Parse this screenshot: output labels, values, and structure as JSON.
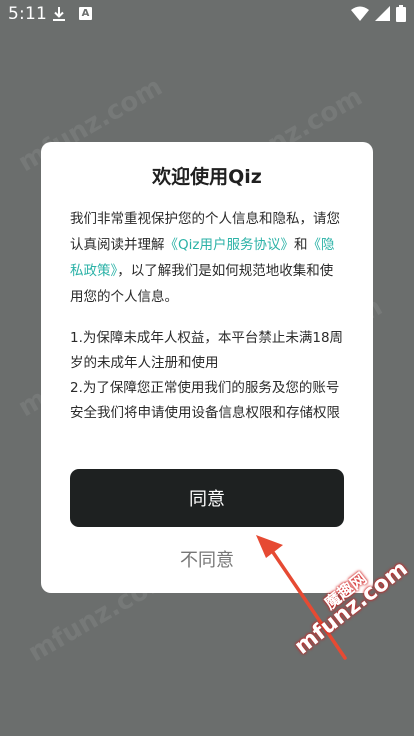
{
  "status_bar": {
    "time": "5:11",
    "notification_a": "A"
  },
  "watermark": {
    "text": "mfunz.com",
    "brand_cn": "魔趣网",
    "brand_url": "mfunz.com"
  },
  "dialog": {
    "title": "欢迎使用Qiz",
    "intro_before": "我们非常重视保护您的个人信息和隐私，请您认真阅读并理解",
    "service_agreement_link": "《Qiz用户服务协议》",
    "and_text": "和",
    "privacy_policy_link": "《隐私政策》",
    "intro_after": "，以了解我们是如何规范地收集和使用您的个人信息。",
    "term_1": "1.为保障未成年人权益，本平台禁止未满18周岁的未成年人注册和使用",
    "term_2": "2.为了保障您正常使用我们的服务及您的账号安全我们将申请使用设备信息权限和存储权限",
    "agree_label": "同意",
    "disagree_label": "不同意"
  },
  "colors": {
    "overlay": "#6b6e6d",
    "link": "#2bb2a7",
    "agree_button": "#1e2121",
    "arrow": "#e64a33"
  }
}
